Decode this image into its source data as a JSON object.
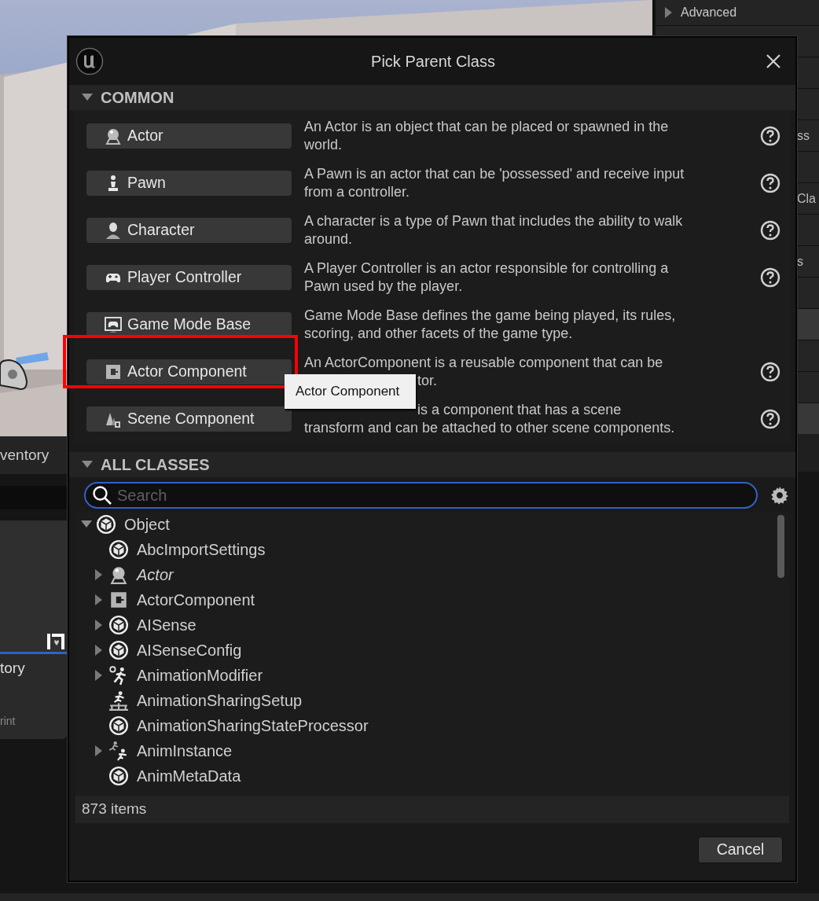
{
  "background": {
    "details_panel": {
      "header": "Advanced",
      "rows": [
        {
          "highlighted": false
        },
        {
          "highlighted": false
        },
        {
          "highlighted": false
        },
        {
          "highlighted": false,
          "label": "ss"
        },
        {
          "highlighted": false
        },
        {
          "highlighted": false,
          "label": "Cla"
        },
        {
          "highlighted": false
        },
        {
          "highlighted": false,
          "label": "s"
        },
        {
          "highlighted": false
        },
        {
          "highlighted": true
        },
        {
          "highlighted": false
        },
        {
          "highlighted": false
        },
        {
          "highlighted": true
        }
      ]
    },
    "content_tab": "ventory",
    "asset_card": {
      "title": "tory",
      "subtitle": "rint"
    }
  },
  "dialog": {
    "title": "Pick Parent Class",
    "common": {
      "header": "COMMON",
      "expanded": true,
      "items": [
        {
          "kind": "actor",
          "label": "Actor",
          "help": true,
          "highlighted": false,
          "lines": [
            {
              "text": "An Actor is an object that can be placed or spawned in the",
              "covered": false
            },
            {
              "text": "world.",
              "covered": false
            }
          ]
        },
        {
          "kind": "pawn",
          "label": "Pawn",
          "help": true,
          "highlighted": false,
          "lines": [
            {
              "text": "A Pawn is an actor that can be 'possessed' and receive input",
              "covered": false
            },
            {
              "text": "from a controller.",
              "covered": false
            }
          ]
        },
        {
          "kind": "character",
          "label": "Character",
          "help": true,
          "highlighted": false,
          "lines": [
            {
              "text": "A character is a type of Pawn that includes the ability to walk",
              "covered": false
            },
            {
              "text": "around.",
              "covered": false
            }
          ]
        },
        {
          "kind": "controller",
          "label": "Player Controller",
          "help": true,
          "highlighted": false,
          "lines": [
            {
              "text": "A Player Controller is an actor responsible for controlling a",
              "covered": false
            },
            {
              "text": "Pawn used by the player.",
              "covered": false
            }
          ]
        },
        {
          "kind": "gamemode",
          "label": "Game Mode Base",
          "help": false,
          "highlighted": false,
          "lines": [
            {
              "text": "Game Mode Base defines the game being played, its rules,",
              "covered": false
            },
            {
              "text": "scoring, and other facets of the game type.",
              "covered": false
            }
          ]
        },
        {
          "kind": "component",
          "label": "Actor Component",
          "help": true,
          "highlighted": true,
          "lines": [
            {
              "text": "An ActorComponent is a reusable component that can be",
              "covered": false
            },
            {
              "text": "tor.",
              "covered": true
            }
          ]
        },
        {
          "kind": "scene",
          "label": "Scene Component",
          "help": true,
          "highlighted": false,
          "lines": [
            {
              "text": "is a component that has a scene",
              "covered": true
            },
            {
              "text": "transform and can be attached to other scene components.",
              "covered": false
            }
          ]
        }
      ]
    },
    "tooltip": "Actor Component",
    "all_classes": {
      "header": "ALL CLASSES",
      "expanded": true,
      "search": {
        "placeholder": "Search"
      },
      "tree": [
        {
          "kind": "cube",
          "label": "Object",
          "expanded": true,
          "italic": false,
          "children": [
            {
              "kind": "cube",
              "label": "AbcImportSettings",
              "expandable": false,
              "italic": false
            },
            {
              "kind": "actor",
              "label": "Actor",
              "expandable": true,
              "italic": true
            },
            {
              "kind": "component",
              "label": "ActorComponent",
              "expandable": true,
              "italic": false
            },
            {
              "kind": "cube",
              "label": "AISense",
              "expandable": true,
              "italic": false
            },
            {
              "kind": "cube",
              "label": "AISenseConfig",
              "expandable": true,
              "italic": false
            },
            {
              "kind": "anim_gear",
              "label": "AnimationModifier",
              "expandable": true,
              "italic": false
            },
            {
              "kind": "anim_setup",
              "label": "AnimationSharingSetup",
              "expandable": false,
              "italic": false
            },
            {
              "kind": "cube",
              "label": "AnimationSharingStateProcessor",
              "expandable": false,
              "italic": false
            },
            {
              "kind": "anim_instance",
              "label": "AnimInstance",
              "expandable": true,
              "italic": false
            },
            {
              "kind": "cube",
              "label": "AnimMetaData",
              "expandable": false,
              "italic": false
            }
          ]
        }
      ],
      "count": "873 items"
    },
    "buttons": [
      "Cancel"
    ]
  }
}
